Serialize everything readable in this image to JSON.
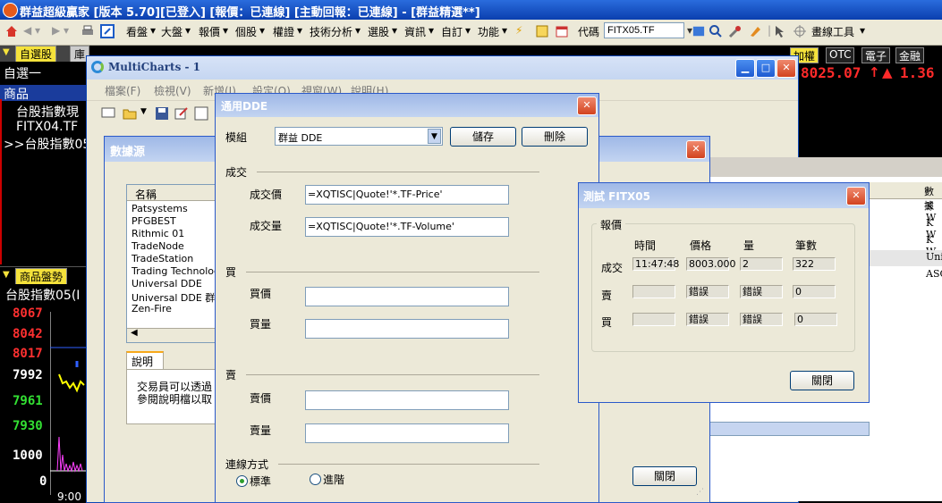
{
  "app": {
    "title": "群益超級贏家 [版本 5.70][已登入] [報價：已連線] [主動回報：已連線] - [群益精選**]"
  },
  "toolbar": {
    "menus": [
      "看盤",
      "大盤",
      "報價",
      "個股",
      "權證",
      "技術分析",
      "選股",
      "資訊",
      "自訂",
      "功能"
    ],
    "code_label": "代碼",
    "code_value": "FITX05.TF",
    "draw_tool_label": "畫線工具"
  },
  "left_panel": {
    "tab_label": "自選股",
    "tab_next": "庫",
    "group_name": "自選一",
    "header": "商品",
    "items": [
      "台股指數現",
      "FITX04.TF",
      ">>台股指數05"
    ]
  },
  "chart_panel": {
    "tab_label": "商品盤勢",
    "symbol": "台股指數05(I",
    "price_labels": [
      "8067",
      "8042",
      "8017",
      "7992",
      "7961",
      "7930",
      "1000",
      "0"
    ],
    "time_label": "9:00"
  },
  "right_strip": {
    "tabs": [
      "加權",
      "OTC",
      "電子",
      "金融"
    ],
    "price": "8025.07",
    "change": "1.36",
    "up_color": "#ff2a2a"
  },
  "multicharts": {
    "title": "MultiCharts - 1",
    "menu": [
      "檔案(F)",
      "檢視(V)",
      "新增(I)",
      "設定(O)",
      "視窗(W)",
      "說明(H)"
    ]
  },
  "data_source": {
    "title": "數據源",
    "column_header": "名稱",
    "items": [
      "Patsystems",
      "PFGBEST",
      "Rithmic 01",
      "TradeNode",
      "TradeStation",
      "Trading Technologie",
      "Universal DDE",
      "Universal DDE 群益",
      "Zen-Fire"
    ],
    "desc_tab": "說明",
    "desc_lines": [
      "交易員可以透過",
      "參閱說明檔以取"
    ],
    "close_label": "關閉",
    "grid_right_header": "數據",
    "grid_right_values": [
      "K W",
      "K W",
      "K W",
      "Uni",
      "ASC"
    ]
  },
  "dde": {
    "title": "通用DDE",
    "module_label": "模組",
    "module_value": "群益 DDE",
    "save_label": "儲存",
    "delete_label": "刪除",
    "trade_section": "成交",
    "trade_price_label": "成交價",
    "trade_price_value": "=XQTISC|Quote!'*.TF-Price'",
    "trade_volume_label": "成交量",
    "trade_volume_value": "=XQTISC|Quote!'*.TF-Volume'",
    "buy_section": "買",
    "buy_price_label": "買價",
    "buy_volume_label": "買量",
    "sell_section": "賣",
    "sell_price_label": "賣價",
    "sell_volume_label": "賣量",
    "conn_label": "連線方式",
    "conn_standard": "標準",
    "conn_advanced": "進階"
  },
  "test": {
    "title": "測試 FITX05",
    "group_label": "報價",
    "headers": [
      "時間",
      "價格",
      "量",
      "筆數"
    ],
    "rows": [
      {
        "label": "成交",
        "time": "11:47:48",
        "price": "8003.000",
        "qty": "2",
        "count": "322"
      },
      {
        "label": "賣",
        "time": "",
        "price": "錯誤",
        "qty": "錯誤",
        "count": "0"
      },
      {
        "label": "買",
        "time": "",
        "price": "錯誤",
        "qty": "錯誤",
        "count": "0"
      }
    ],
    "close_label": "關閉"
  }
}
